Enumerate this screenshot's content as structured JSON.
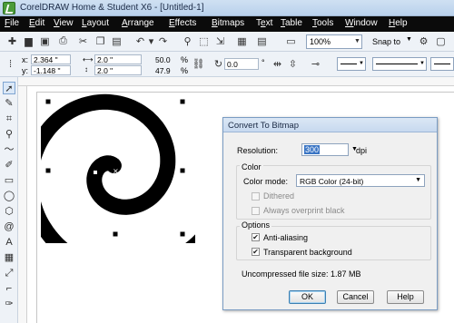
{
  "window": {
    "title": "CorelDRAW Home & Student X6 - [Untitled-1]"
  },
  "menu": [
    {
      "label": "File",
      "u": "F",
      "rest": "ile"
    },
    {
      "label": "Edit",
      "u": "E",
      "rest": "dit"
    },
    {
      "label": "View",
      "u": "V",
      "rest": "iew"
    },
    {
      "label": "Layout",
      "u": "L",
      "rest": "ayout"
    },
    {
      "label": "Arrange",
      "u": "A",
      "rest": "rrange"
    },
    {
      "label": "Effects",
      "u": "E",
      "rest": "ffects"
    },
    {
      "label": "Bitmaps",
      "u": "B",
      "rest": "itmaps"
    },
    {
      "label": "Text",
      "u": "T",
      "rest": "e",
      "tail": "xt"
    },
    {
      "label": "Table",
      "u": "T",
      "rest": "able"
    },
    {
      "label": "Tools",
      "u": "T",
      "rest": "ools"
    },
    {
      "label": "Window",
      "u": "W",
      "rest": "indow"
    },
    {
      "label": "Help",
      "u": "H",
      "rest": "elp"
    }
  ],
  "standard_toolbar": {
    "zoom": "100%",
    "snap_to": "Snap to"
  },
  "property_bar": {
    "x_label": "x:",
    "x_value": "2.364 \"",
    "y_label": "y:",
    "y_value": "-1.148 \"",
    "w_value": "2.0 \"",
    "h_value": "2.0 \"",
    "scale_x": "50.0",
    "scale_y": "47.9",
    "percent": "%",
    "rotation": "0.0",
    "degree": "°"
  },
  "dialog": {
    "title": "Convert To Bitmap",
    "resolution_label": "Resolution:",
    "resolution_value": "300",
    "resolution_unit": "dpi",
    "color_group": "Color",
    "color_mode_label": "Color mode:",
    "color_mode_value": "RGB Color (24-bit)",
    "dithered_label": "Dithered",
    "overprint_label": "Always overprint black",
    "options_group": "Options",
    "antialias_label": "Anti-aliasing",
    "transparent_label": "Transparent background",
    "file_size": "Uncompressed file size: 1.87 MB",
    "ok": "OK",
    "cancel": "Cancel",
    "help": "Help"
  },
  "checkboxes": {
    "dithered": false,
    "overprint": false,
    "antialias": true,
    "transparent": true
  },
  "colors": {
    "menubar": "#0b0b0b",
    "selection": "#3a75c4",
    "spiral": "#000000"
  },
  "icons": {
    "toolbar": [
      "new-icon",
      "open-icon",
      "save-icon",
      "print-icon",
      "cut-icon",
      "copy-icon",
      "paste-icon",
      "undo-icon",
      "redo-icon",
      "search-icon",
      "import-icon",
      "export-icon",
      "application-launcher-icon",
      "publish-pdf-icon"
    ],
    "toolbox": [
      "pick-tool-icon",
      "shape-tool-icon",
      "crop-tool-icon",
      "zoom-tool-icon",
      "freehand-tool-icon",
      "smart-fill-icon",
      "rectangle-tool-icon",
      "ellipse-tool-icon",
      "polygon-tool-icon",
      "spiral-tool-icon",
      "text-tool-icon",
      "table-tool-icon",
      "dimension-tool-icon",
      "connector-tool-icon",
      "eyedropper-tool-icon",
      "fill-tool-icon"
    ]
  }
}
